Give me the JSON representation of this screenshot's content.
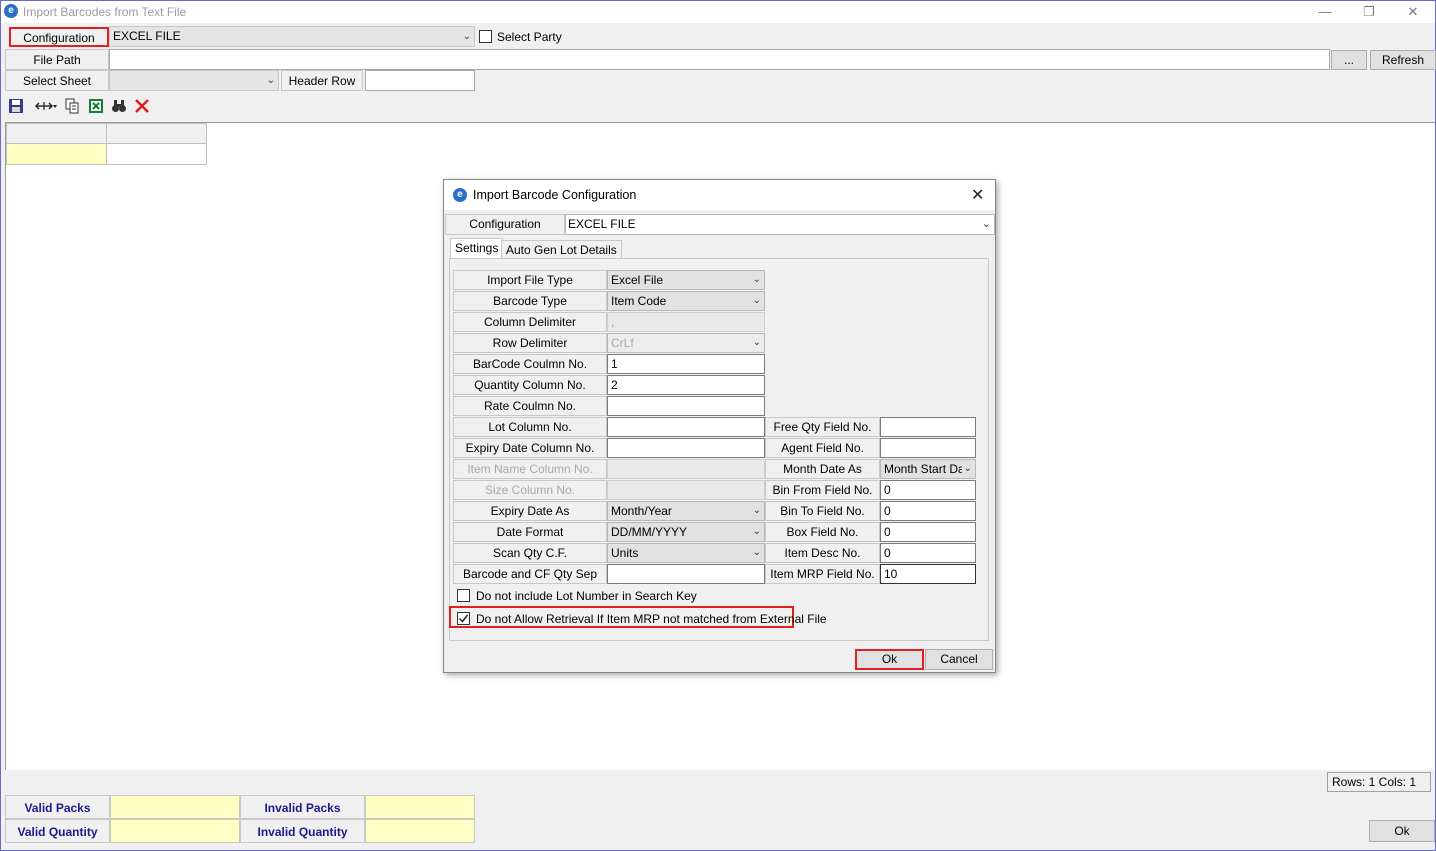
{
  "window": {
    "title": "Import Barcodes from Text File",
    "app_icon": "app-logo-icon",
    "minimize": "—",
    "restore": "❐",
    "close": "✕"
  },
  "top": {
    "configuration_label": "Configuration",
    "configuration_value": "EXCEL FILE",
    "select_party_label": "Select Party",
    "select_party_checked": false,
    "file_path_label": "File Path",
    "file_path_value": "",
    "browse_label": "...",
    "refresh_label": "Refresh",
    "select_sheet_label": "Select Sheet",
    "select_sheet_value": "",
    "header_row_label": "Header Row",
    "header_row_value": ""
  },
  "toolbar": {
    "icons": [
      "save-icon",
      "column-width-icon",
      "copy-icon",
      "excel-icon",
      "find-icon",
      "delete-icon"
    ]
  },
  "status": {
    "rows_cols": "Rows: 1  Cols: 1"
  },
  "summary": {
    "valid_packs_label": "Valid Packs",
    "valid_packs_value": "",
    "invalid_packs_label": "Invalid Packs",
    "invalid_packs_value": "",
    "valid_quantity_label": "Valid Quantity",
    "valid_quantity_value": "",
    "invalid_quantity_label": "Invalid Quantity",
    "invalid_quantity_value": "",
    "ok_label": "Ok"
  },
  "dialog": {
    "title": "Import Barcode Configuration",
    "close": "✕",
    "configuration_label": "Configuration",
    "configuration_value": "EXCEL FILE",
    "tabs": [
      "Settings",
      "Auto Gen Lot Details"
    ],
    "left_fields": [
      {
        "label": "Import File Type",
        "value": "Excel File"
      },
      {
        "label": "Barcode Type",
        "value": "Item Code"
      },
      {
        "label": "Column Delimiter",
        "value": ","
      },
      {
        "label": "Row Delimiter",
        "value": "CrLf"
      },
      {
        "label": "BarCode Coulmn No.",
        "value": "1"
      },
      {
        "label": "Quantity Column No.",
        "value": "2"
      },
      {
        "label": "Rate Coulmn No.",
        "value": ""
      },
      {
        "label": "Lot Column No.",
        "value": ""
      },
      {
        "label": "Expiry Date Column No.",
        "value": ""
      },
      {
        "label": "Item Name Column No.",
        "value": ""
      },
      {
        "label": "Size Column No.",
        "value": ""
      },
      {
        "label": "Expiry Date As",
        "value": "Month/Year"
      },
      {
        "label": "Date Format",
        "value": "DD/MM/YYYY"
      },
      {
        "label": "Scan Qty C.F.",
        "value": "Units"
      },
      {
        "label": "Barcode and CF Qty Sep",
        "value": ""
      }
    ],
    "right_fields": [
      {
        "label": "Free Qty Field No.",
        "value": ""
      },
      {
        "label": "Agent Field No.",
        "value": ""
      },
      {
        "label": "Month Date As",
        "value": "Month Start Da"
      },
      {
        "label": "Bin From Field No.",
        "value": "0"
      },
      {
        "label": "Bin To Field No.",
        "value": "0"
      },
      {
        "label": "Box Field No.",
        "value": "0"
      },
      {
        "label": "Item Desc No.",
        "value": "0"
      },
      {
        "label": "Item MRP Field No.",
        "value": "10"
      }
    ],
    "chk_lot_label": "Do not include Lot Number in Search Key",
    "chk_lot_checked": false,
    "chk_mrp_label": "Do not Allow Retrieval If Item MRP not matched from External File",
    "chk_mrp_checked": true,
    "ok_label": "Ok",
    "cancel_label": "Cancel"
  }
}
